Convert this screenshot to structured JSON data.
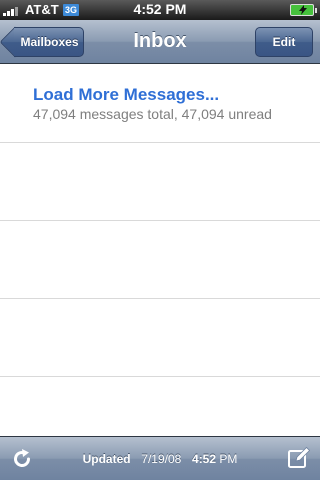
{
  "status_bar": {
    "carrier": "AT&T",
    "network": "3G",
    "time": "4:52 PM",
    "battery": "charging"
  },
  "nav": {
    "back_label": "Mailboxes",
    "title": "Inbox",
    "edit_label": "Edit"
  },
  "list": {
    "load_more": "Load More Messages...",
    "summary": "47,094 messages total, 47,094 unread"
  },
  "toolbar": {
    "updated_label": "Updated",
    "updated_date": "7/19/08",
    "updated_time": "4:52",
    "updated_ampm": "PM",
    "refresh_icon": "refresh-icon",
    "compose_icon": "compose-icon"
  },
  "colors": {
    "link_blue": "#2f6fd6",
    "bar_blue": "#6f83a0"
  }
}
